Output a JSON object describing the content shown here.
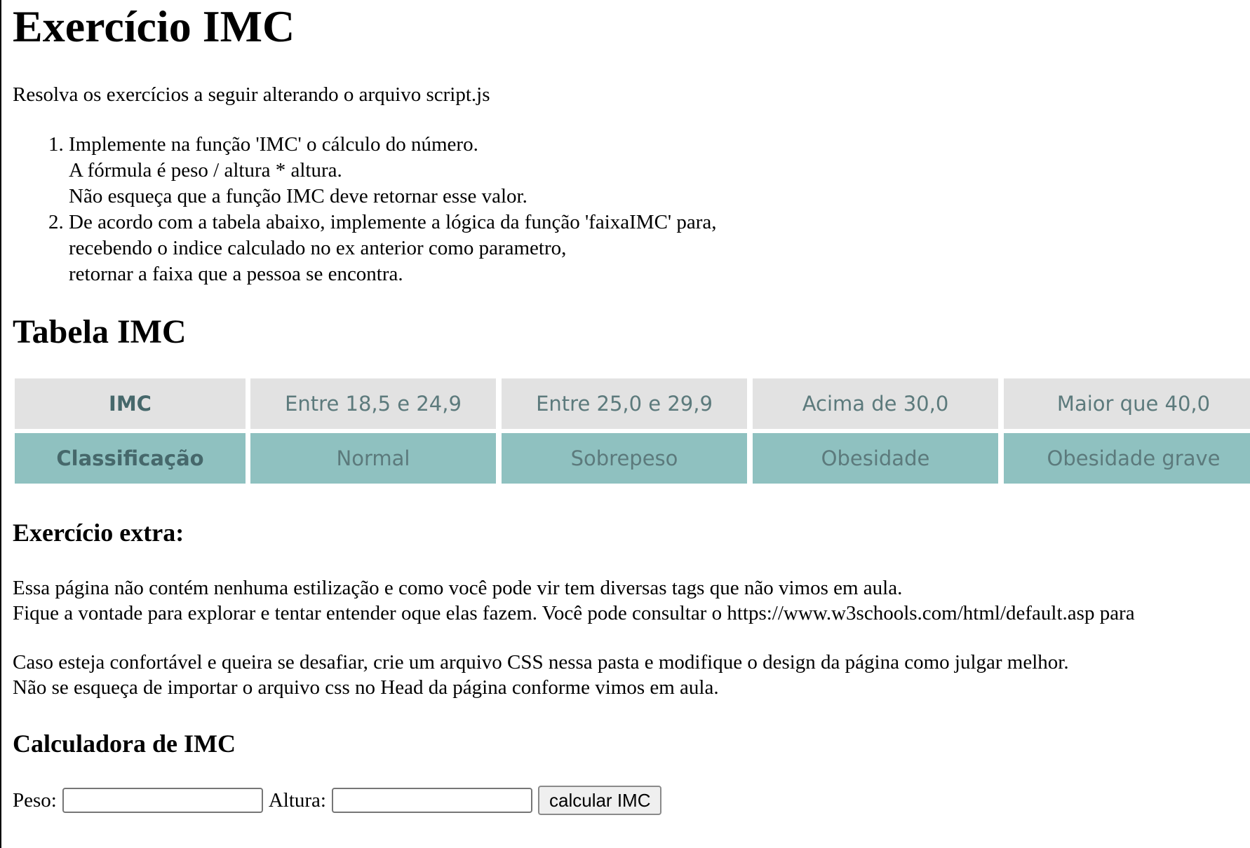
{
  "page": {
    "title": "Exercício IMC",
    "intro": "Resolva os exercícios a seguir alterando o arquivo script.js"
  },
  "tasks": [
    {
      "lines": [
        "Implemente na função 'IMC' o cálculo do número.",
        "A fórmula é peso / altura * altura.",
        "Não esqueça que a função IMC deve retornar esse valor."
      ]
    },
    {
      "lines": [
        "De acordo com a tabela abaixo, implemente a lógica da função 'faixaIMC' para,",
        "recebendo o indice calculado no ex anterior como parametro,",
        "retornar a faixa que a pessoa se encontra."
      ]
    }
  ],
  "tabela": {
    "title": "Tabela IMC",
    "rows": [
      [
        "IMC",
        "Entre 18,5 e 24,9",
        "Entre 25,0 e 29,9",
        "Acima de 30,0",
        "Maior que 40,0"
      ],
      [
        "Classificação",
        "Normal",
        "Sobrepeso",
        "Obesidade",
        "Obesidade grave"
      ]
    ],
    "colors": {
      "header_row_bg": "#e2e2e2",
      "class_row_bg": "#8fc1c0",
      "text": "#5c7a7c"
    }
  },
  "extra": {
    "title": "Exercício extra:",
    "para1": [
      "Essa página não contém nenhuma estilização e como você pode vir tem diversas tags que não vimos em aula.",
      "Fique a vontade para explorar e tentar entender oque elas fazem. Você pode consultar o https://www.w3schools.com/html/default.asp para"
    ],
    "para2": [
      "Caso esteja confortável e queira se desafiar, crie um arquivo CSS nessa pasta e modifique o design da página como julgar melhor.",
      "Não se esqueça de importar o arquivo css no Head da página conforme vimos em aula."
    ]
  },
  "calculadora": {
    "title": "Calculadora de IMC",
    "peso_label": "Peso:",
    "peso_value": "",
    "altura_label": "Altura:",
    "altura_value": "",
    "button_label": "calcular IMC"
  }
}
